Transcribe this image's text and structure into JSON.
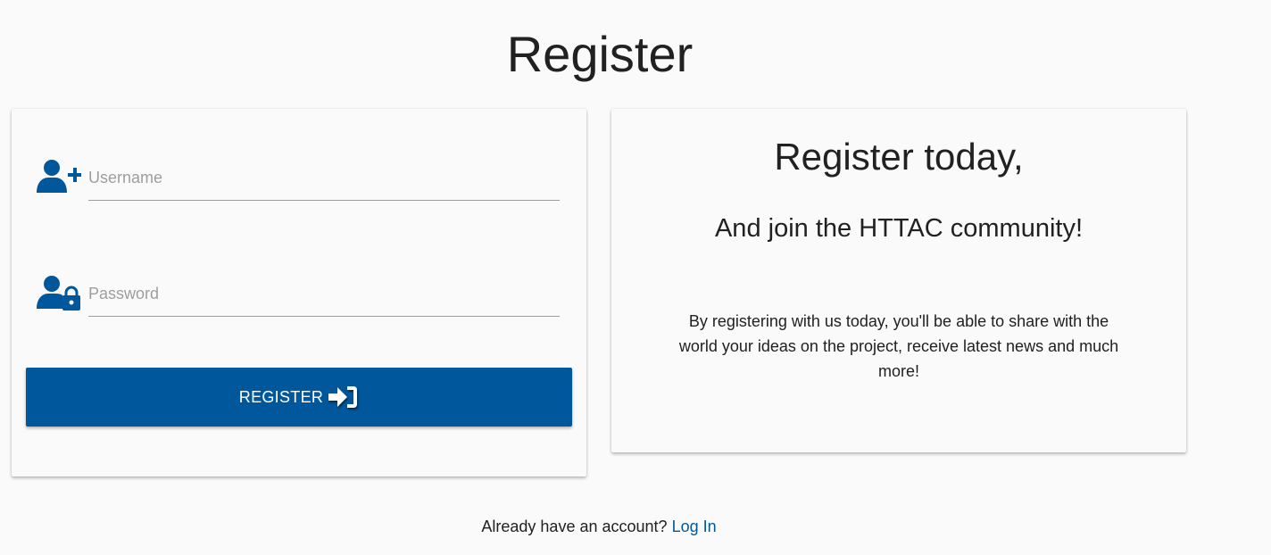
{
  "page": {
    "title": "Register"
  },
  "form": {
    "username": {
      "placeholder": "Username",
      "value": "",
      "icon": "user-plus-icon"
    },
    "password": {
      "placeholder": "Password",
      "value": "",
      "icon": "user-lock-icon"
    },
    "register_label": "REGISTER",
    "register_icon": "sign-in-icon"
  },
  "info": {
    "title": "Register today,",
    "subtitle": "And join the HTTAC community!",
    "body": "By registering with us today, you'll be able to share with the world your ideas on the project, receive latest news and much more!"
  },
  "footer": {
    "prompt": "Already have an account?",
    "login_link": "Log In"
  },
  "colors": {
    "primary": "#01579b",
    "background": "#fafafa",
    "text": "#212121",
    "muted": "#9e9e9e"
  }
}
